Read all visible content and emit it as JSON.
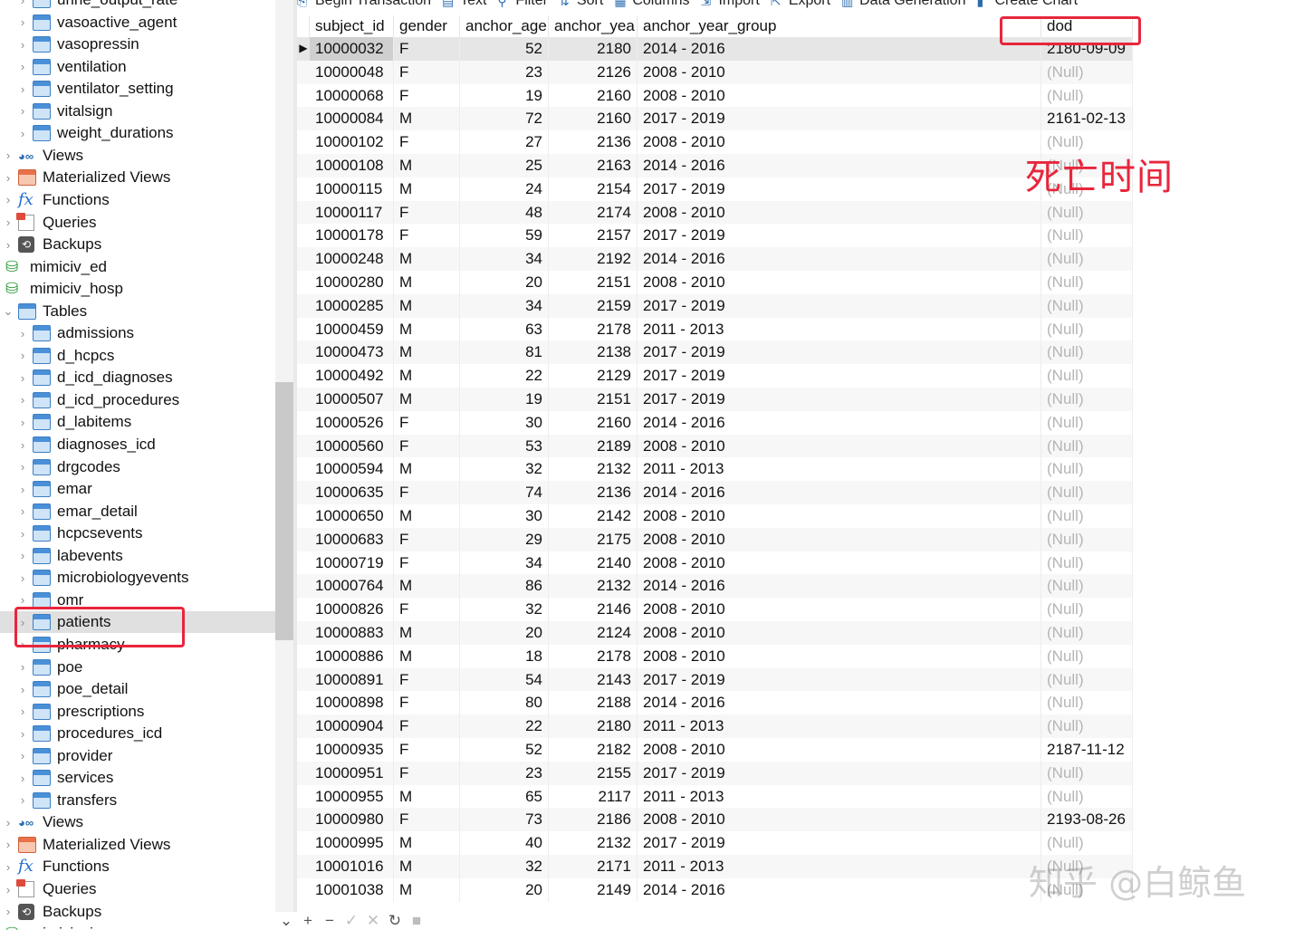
{
  "toolbar": {
    "items": [
      {
        "label": "Begin Transaction",
        "icon": "transaction-icon"
      },
      {
        "label": "Text",
        "icon": "text-icon"
      },
      {
        "label": "Filter",
        "icon": "filter-icon"
      },
      {
        "label": "Sort",
        "icon": "sort-icon"
      },
      {
        "label": "Columns",
        "icon": "columns-icon"
      },
      {
        "label": "Import",
        "icon": "import-icon"
      },
      {
        "label": "Export",
        "icon": "export-icon"
      },
      {
        "label": "Data Generation",
        "icon": "data-generation-icon"
      },
      {
        "label": "Create Chart",
        "icon": "chart-icon"
      }
    ]
  },
  "sidebar": {
    "items": [
      {
        "label": "urine_output_rate",
        "type": "table",
        "level": 2
      },
      {
        "label": "vasoactive_agent",
        "type": "table",
        "level": 2
      },
      {
        "label": "vasopressin",
        "type": "table",
        "level": 2
      },
      {
        "label": "ventilation",
        "type": "table",
        "level": 2
      },
      {
        "label": "ventilator_setting",
        "type": "table",
        "level": 2
      },
      {
        "label": "vitalsign",
        "type": "table",
        "level": 2
      },
      {
        "label": "weight_durations",
        "type": "table",
        "level": 2
      },
      {
        "label": "Views",
        "type": "views",
        "level": 1
      },
      {
        "label": "Materialized Views",
        "type": "mat",
        "level": 1
      },
      {
        "label": "Functions",
        "type": "fx",
        "level": 1
      },
      {
        "label": "Queries",
        "type": "query",
        "level": 1
      },
      {
        "label": "Backups",
        "type": "backup",
        "level": 1
      },
      {
        "label": "mimiciv_ed",
        "type": "db",
        "level": 0
      },
      {
        "label": "mimiciv_hosp",
        "type": "db",
        "level": 0
      },
      {
        "label": "Tables",
        "type": "table",
        "level": 1,
        "expanded": true
      },
      {
        "label": "admissions",
        "type": "table",
        "level": 2
      },
      {
        "label": "d_hcpcs",
        "type": "table",
        "level": 2
      },
      {
        "label": "d_icd_diagnoses",
        "type": "table",
        "level": 2
      },
      {
        "label": "d_icd_procedures",
        "type": "table",
        "level": 2
      },
      {
        "label": "d_labitems",
        "type": "table",
        "level": 2
      },
      {
        "label": "diagnoses_icd",
        "type": "table",
        "level": 2
      },
      {
        "label": "drgcodes",
        "type": "table",
        "level": 2
      },
      {
        "label": "emar",
        "type": "table",
        "level": 2
      },
      {
        "label": "emar_detail",
        "type": "table",
        "level": 2
      },
      {
        "label": "hcpcsevents",
        "type": "table",
        "level": 2
      },
      {
        "label": "labevents",
        "type": "table",
        "level": 2
      },
      {
        "label": "microbiologyevents",
        "type": "table",
        "level": 2
      },
      {
        "label": "omr",
        "type": "table",
        "level": 2
      },
      {
        "label": "patients",
        "type": "table",
        "level": 2,
        "selected": true
      },
      {
        "label": "pharmacy",
        "type": "table",
        "level": 2
      },
      {
        "label": "poe",
        "type": "table",
        "level": 2
      },
      {
        "label": "poe_detail",
        "type": "table",
        "level": 2
      },
      {
        "label": "prescriptions",
        "type": "table",
        "level": 2
      },
      {
        "label": "procedures_icd",
        "type": "table",
        "level": 2
      },
      {
        "label": "provider",
        "type": "table",
        "level": 2
      },
      {
        "label": "services",
        "type": "table",
        "level": 2
      },
      {
        "label": "transfers",
        "type": "table",
        "level": 2
      },
      {
        "label": "Views",
        "type": "views",
        "level": 1
      },
      {
        "label": "Materialized Views",
        "type": "mat",
        "level": 1
      },
      {
        "label": "Functions",
        "type": "fx",
        "level": 1
      },
      {
        "label": "Queries",
        "type": "query",
        "level": 1
      },
      {
        "label": "Backups",
        "type": "backup",
        "level": 1
      },
      {
        "label": "mimiciv_icu",
        "type": "db",
        "level": 0
      }
    ]
  },
  "grid": {
    "columns": [
      "subject_id",
      "gender",
      "anchor_age",
      "anchor_yea",
      "anchor_year_group",
      "dod"
    ],
    "rows": [
      [
        "10000032",
        "F",
        "52",
        "2180",
        "2014 - 2016",
        "2180-09-09"
      ],
      [
        "10000048",
        "F",
        "23",
        "2126",
        "2008 - 2010",
        "(Null)"
      ],
      [
        "10000068",
        "F",
        "19",
        "2160",
        "2008 - 2010",
        "(Null)"
      ],
      [
        "10000084",
        "M",
        "72",
        "2160",
        "2017 - 2019",
        "2161-02-13"
      ],
      [
        "10000102",
        "F",
        "27",
        "2136",
        "2008 - 2010",
        "(Null)"
      ],
      [
        "10000108",
        "M",
        "25",
        "2163",
        "2014 - 2016",
        "(Null)"
      ],
      [
        "10000115",
        "M",
        "24",
        "2154",
        "2017 - 2019",
        "(Null)"
      ],
      [
        "10000117",
        "F",
        "48",
        "2174",
        "2008 - 2010",
        "(Null)"
      ],
      [
        "10000178",
        "F",
        "59",
        "2157",
        "2017 - 2019",
        "(Null)"
      ],
      [
        "10000248",
        "M",
        "34",
        "2192",
        "2014 - 2016",
        "(Null)"
      ],
      [
        "10000280",
        "M",
        "20",
        "2151",
        "2008 - 2010",
        "(Null)"
      ],
      [
        "10000285",
        "M",
        "34",
        "2159",
        "2017 - 2019",
        "(Null)"
      ],
      [
        "10000459",
        "M",
        "63",
        "2178",
        "2011 - 2013",
        "(Null)"
      ],
      [
        "10000473",
        "M",
        "81",
        "2138",
        "2017 - 2019",
        "(Null)"
      ],
      [
        "10000492",
        "M",
        "22",
        "2129",
        "2017 - 2019",
        "(Null)"
      ],
      [
        "10000507",
        "M",
        "19",
        "2151",
        "2017 - 2019",
        "(Null)"
      ],
      [
        "10000526",
        "F",
        "30",
        "2160",
        "2014 - 2016",
        "(Null)"
      ],
      [
        "10000560",
        "F",
        "53",
        "2189",
        "2008 - 2010",
        "(Null)"
      ],
      [
        "10000594",
        "M",
        "32",
        "2132",
        "2011 - 2013",
        "(Null)"
      ],
      [
        "10000635",
        "F",
        "74",
        "2136",
        "2014 - 2016",
        "(Null)"
      ],
      [
        "10000650",
        "M",
        "30",
        "2142",
        "2008 - 2010",
        "(Null)"
      ],
      [
        "10000683",
        "F",
        "29",
        "2175",
        "2008 - 2010",
        "(Null)"
      ],
      [
        "10000719",
        "F",
        "34",
        "2140",
        "2008 - 2010",
        "(Null)"
      ],
      [
        "10000764",
        "M",
        "86",
        "2132",
        "2014 - 2016",
        "(Null)"
      ],
      [
        "10000826",
        "F",
        "32",
        "2146",
        "2008 - 2010",
        "(Null)"
      ],
      [
        "10000883",
        "M",
        "20",
        "2124",
        "2008 - 2010",
        "(Null)"
      ],
      [
        "10000886",
        "M",
        "18",
        "2178",
        "2008 - 2010",
        "(Null)"
      ],
      [
        "10000891",
        "F",
        "54",
        "2143",
        "2017 - 2019",
        "(Null)"
      ],
      [
        "10000898",
        "F",
        "80",
        "2188",
        "2014 - 2016",
        "(Null)"
      ],
      [
        "10000904",
        "F",
        "22",
        "2180",
        "2011 - 2013",
        "(Null)"
      ],
      [
        "10000935",
        "F",
        "52",
        "2182",
        "2008 - 2010",
        "2187-11-12"
      ],
      [
        "10000951",
        "F",
        "23",
        "2155",
        "2017 - 2019",
        "(Null)"
      ],
      [
        "10000955",
        "M",
        "65",
        "2117",
        "2011 - 2013",
        "(Null)"
      ],
      [
        "10000980",
        "F",
        "73",
        "2186",
        "2008 - 2010",
        "2193-08-26"
      ],
      [
        "10000995",
        "M",
        "40",
        "2132",
        "2017 - 2019",
        "(Null)"
      ],
      [
        "10001016",
        "M",
        "32",
        "2171",
        "2011 - 2013",
        "(Null)"
      ],
      [
        "10001038",
        "M",
        "20",
        "2149",
        "2014 - 2016",
        "(Null)"
      ]
    ],
    "selected_row": 0
  },
  "annotation": {
    "label": "死亡时间",
    "color": "#e8263c"
  },
  "watermark": "知乎 @白鲸鱼",
  "bottombar": {
    "buttons": [
      "+",
      "−",
      "✓",
      "✕",
      "↻",
      "■"
    ]
  }
}
